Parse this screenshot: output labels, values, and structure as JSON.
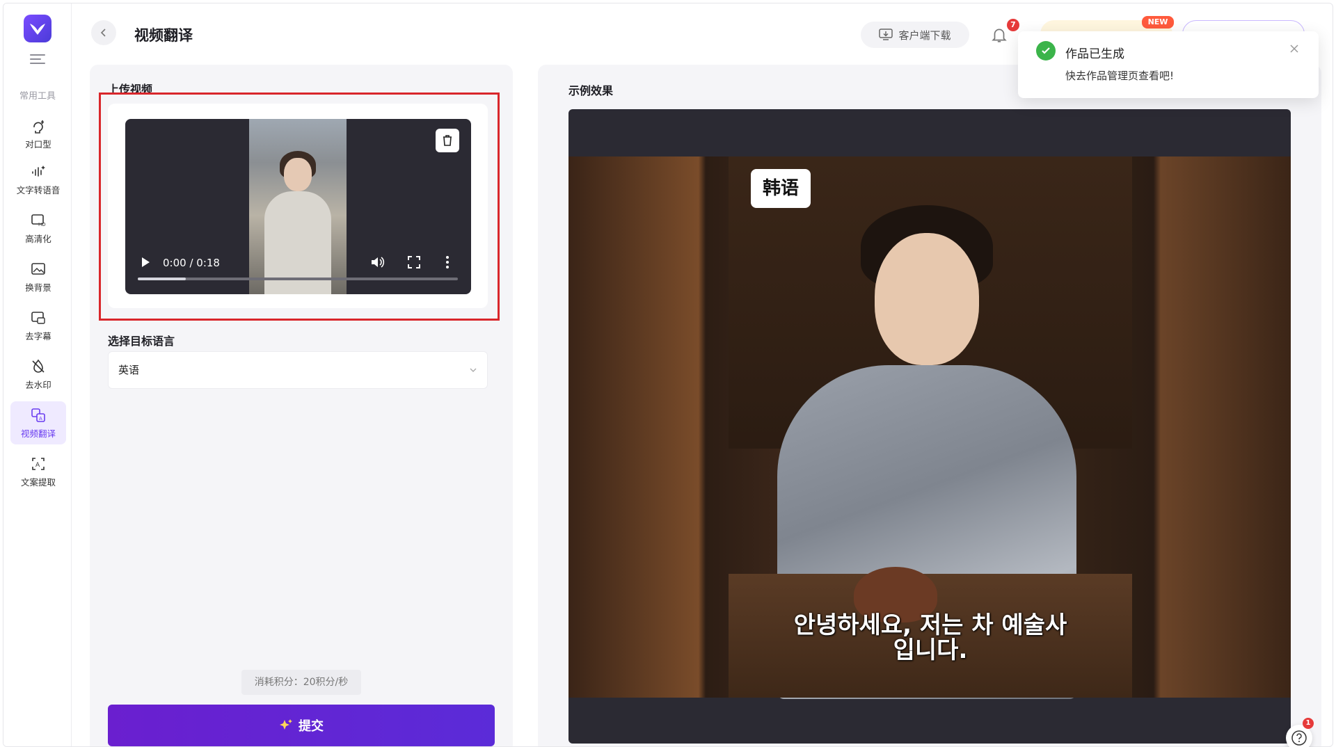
{
  "header": {
    "title": "视频翻译",
    "download_label": "客户端下载",
    "notification_count": "7",
    "new_badge": "NEW"
  },
  "sidebar": {
    "section_label": "常用工具",
    "items": [
      {
        "label": "对口型",
        "icon": "lip-sync-icon"
      },
      {
        "label": "文字转语音",
        "icon": "text-to-speech-icon"
      },
      {
        "label": "高清化",
        "icon": "hd-icon"
      },
      {
        "label": "换背景",
        "icon": "background-swap-icon"
      },
      {
        "label": "去字幕",
        "icon": "remove-subtitle-icon"
      },
      {
        "label": "去水印",
        "icon": "remove-watermark-icon"
      },
      {
        "label": "视频翻译",
        "icon": "video-translate-icon",
        "active": true
      },
      {
        "label": "文案提取",
        "icon": "text-extract-icon"
      }
    ]
  },
  "upload": {
    "label": "上传视频",
    "time": "0:00 / 0:18",
    "progress": 0.15
  },
  "target_language": {
    "label": "选择目标语言",
    "value": "英语"
  },
  "cost": {
    "text": "消耗积分：20积分/秒"
  },
  "submit": {
    "label": "提交"
  },
  "example": {
    "label": "示例效果",
    "lang_tag": "韩语",
    "subtitle_line1": "안녕하세요, 저는 차 예술사",
    "subtitle_line2": "입니다."
  },
  "toast": {
    "title": "作品已生成",
    "body": "快去作品管理页查看吧!"
  },
  "help": {
    "badge": "1"
  },
  "colors": {
    "accent": "#6a3df0",
    "submit": "#5b2bd8",
    "highlight": "#d9262b",
    "success": "#3bb44a"
  }
}
